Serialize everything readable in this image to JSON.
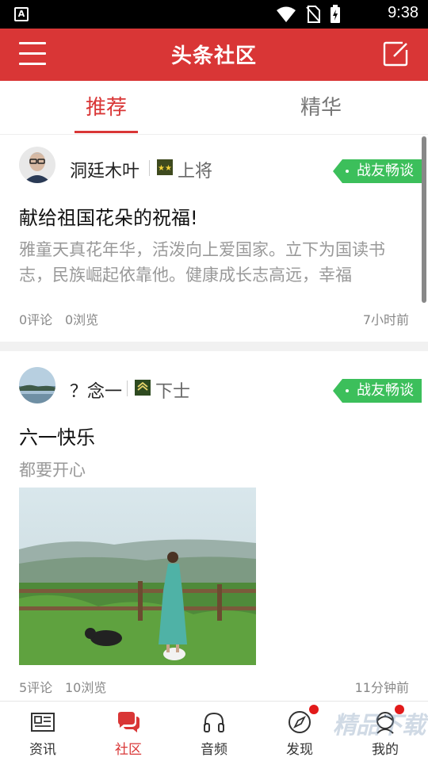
{
  "status_bar": {
    "time": "9:38",
    "left_icon": "A"
  },
  "header": {
    "title": "头条社区"
  },
  "tabs": [
    {
      "label": "推荐",
      "active": true
    },
    {
      "label": "精华",
      "active": false
    }
  ],
  "posts": [
    {
      "username": "洞廷木叶",
      "rank": "上将",
      "tag": "战友畅谈",
      "title": "献给祖国花朵的祝福!",
      "body": "雅童天真花年华，活泼向上爱国家。立下为国读书志，民族崛起依靠他。健康成长志高远，幸福",
      "comments": "0评论",
      "views": "0浏览",
      "time": "7小时前"
    },
    {
      "username": "？念一",
      "rank": "下士",
      "tag": "战友畅谈",
      "title": "六一快乐",
      "body": "都要开心",
      "comments": "5评论",
      "views": "10浏览",
      "time": "11分钟前"
    }
  ],
  "bottom_nav": [
    {
      "label": "资讯",
      "icon": "news-icon",
      "active": false
    },
    {
      "label": "社区",
      "icon": "chat-icon",
      "active": true
    },
    {
      "label": "音频",
      "icon": "headphones-icon",
      "active": false
    },
    {
      "label": "发现",
      "icon": "compass-icon",
      "active": false,
      "badge": true
    },
    {
      "label": "我的",
      "icon": "profile-icon",
      "active": false,
      "badge": true
    }
  ],
  "colors": {
    "brand": "#d93636",
    "tag": "#3cbf5b",
    "badge": "#e21a1a"
  },
  "watermark": "精品下载"
}
